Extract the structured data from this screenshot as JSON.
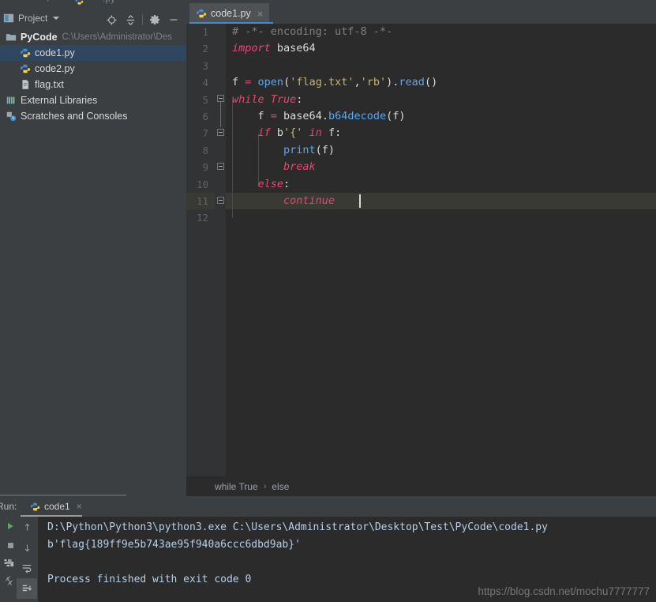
{
  "app": {
    "theme_bg": "#3c3f41",
    "editor_bg": "#2b2b2b",
    "accent": "#4a88c7",
    "selection_bg": "#2f4661"
  },
  "project_panel": {
    "title": "Project",
    "icons": [
      {
        "name": "locate-icon",
        "glyph": "target"
      },
      {
        "name": "collapse-all-icon",
        "glyph": "collapse"
      },
      {
        "name": "settings-gear-icon",
        "glyph": "gear"
      },
      {
        "name": "hide-panel-icon",
        "glyph": "minus"
      }
    ],
    "tree": [
      {
        "label": "PyCode",
        "detail": "C:\\Users\\Administrator\\Des",
        "icon": "folder-icon",
        "depth": 0,
        "bold": true,
        "selected": false
      },
      {
        "label": "code1.py",
        "detail": "",
        "icon": "python-file-icon",
        "depth": 1,
        "bold": false,
        "selected": true
      },
      {
        "label": "code2.py",
        "detail": "",
        "icon": "python-file-icon",
        "depth": 1,
        "bold": false,
        "selected": false
      },
      {
        "label": "flag.txt",
        "detail": "",
        "icon": "text-file-icon",
        "depth": 1,
        "bold": false,
        "selected": false
      },
      {
        "label": "External Libraries",
        "detail": "",
        "icon": "library-icon",
        "depth": 0,
        "bold": false,
        "selected": false
      },
      {
        "label": "Scratches and Consoles",
        "detail": "",
        "icon": "scratches-icon",
        "depth": 0,
        "bold": false,
        "selected": false
      }
    ]
  },
  "editor": {
    "tab": {
      "label": "code1.py",
      "icon": "python-file-icon",
      "close": "×"
    },
    "line_numbers": [
      "1",
      "2",
      "3",
      "4",
      "5",
      "6",
      "7",
      "8",
      "9",
      "10",
      "11",
      "12"
    ],
    "caret_line": 11,
    "code_lines": [
      {
        "n": 1,
        "tokens": [
          {
            "t": "# -*- encoding: utf-8 -*-",
            "c": "cmt"
          }
        ]
      },
      {
        "n": 2,
        "tokens": [
          {
            "t": "import",
            "c": "imp"
          },
          {
            "t": " base64",
            "c": "plain"
          }
        ]
      },
      {
        "n": 3,
        "tokens": []
      },
      {
        "n": 4,
        "tokens": [
          {
            "t": "f ",
            "c": "plain"
          },
          {
            "t": "=",
            "c": "op"
          },
          {
            "t": " ",
            "c": "plain"
          },
          {
            "t": "open",
            "c": "fn"
          },
          {
            "t": "(",
            "c": "plain"
          },
          {
            "t": "'flag.txt'",
            "c": "str"
          },
          {
            "t": ",",
            "c": "plain"
          },
          {
            "t": "'rb'",
            "c": "str"
          },
          {
            "t": ")",
            "c": "plain"
          },
          {
            "t": ".",
            "c": "plain"
          },
          {
            "t": "read",
            "c": "fn"
          },
          {
            "t": "()",
            "c": "plain"
          }
        ]
      },
      {
        "n": 5,
        "tokens": [
          {
            "t": "while",
            "c": "kw2"
          },
          {
            "t": " ",
            "c": "plain"
          },
          {
            "t": "True",
            "c": "kw2"
          },
          {
            "t": ":",
            "c": "plain"
          }
        ]
      },
      {
        "n": 6,
        "tokens": [
          {
            "t": "    f ",
            "c": "plain"
          },
          {
            "t": "=",
            "c": "op"
          },
          {
            "t": " base64.",
            "c": "plain"
          },
          {
            "t": "b64decode",
            "c": "fn"
          },
          {
            "t": "(f)",
            "c": "plain"
          }
        ]
      },
      {
        "n": 7,
        "tokens": [
          {
            "t": "    ",
            "c": "plain"
          },
          {
            "t": "if",
            "c": "kw2"
          },
          {
            "t": " b",
            "c": "plain"
          },
          {
            "t": "'{'",
            "c": "str"
          },
          {
            "t": " ",
            "c": "plain"
          },
          {
            "t": "in",
            "c": "kw2"
          },
          {
            "t": " f:",
            "c": "plain"
          }
        ]
      },
      {
        "n": 8,
        "tokens": [
          {
            "t": "        ",
            "c": "plain"
          },
          {
            "t": "print",
            "c": "fn"
          },
          {
            "t": "(f)",
            "c": "plain"
          }
        ]
      },
      {
        "n": 9,
        "tokens": [
          {
            "t": "        ",
            "c": "plain"
          },
          {
            "t": "break",
            "c": "kw2"
          }
        ]
      },
      {
        "n": 10,
        "tokens": [
          {
            "t": "    ",
            "c": "plain"
          },
          {
            "t": "else",
            "c": "kw2"
          },
          {
            "t": ":",
            "c": "plain"
          }
        ]
      },
      {
        "n": 11,
        "tokens": [
          {
            "t": "        ",
            "c": "plain"
          },
          {
            "t": "continue",
            "c": "kw2"
          }
        ]
      },
      {
        "n": 12,
        "tokens": []
      }
    ],
    "breadcrumb": [
      "while True",
      "else"
    ],
    "breadcrumb_separator": "›"
  },
  "run_panel": {
    "label": "Run:",
    "tab": {
      "label": "code1",
      "icon": "python-file-icon",
      "close": "×"
    },
    "toolbar_icons": [
      {
        "name": "rerun-icon"
      },
      {
        "name": "stop-icon"
      },
      {
        "name": "scroll-up-icon"
      },
      {
        "name": "scroll-down-icon"
      },
      {
        "name": "soft-wrap-icon"
      },
      {
        "name": "scroll-to-end-icon"
      }
    ],
    "console_lines": [
      "D:\\Python\\Python3\\python3.exe C:\\Users\\Administrator\\Desktop\\Test\\PyCode\\code1.py",
      "b'flag{189ff9e5b743ae95f940a6ccc6dbd9ab}'",
      "",
      "Process finished with exit code 0"
    ],
    "watermark": "https://blog.csdn.net/mochu7777777"
  }
}
